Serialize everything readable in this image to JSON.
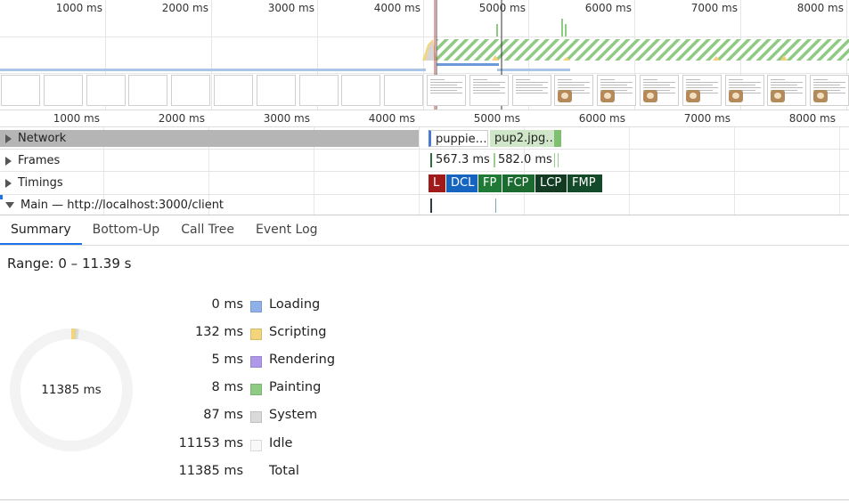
{
  "overview": {
    "ticks": [
      "1000 ms",
      "2000 ms",
      "3000 ms",
      "4000 ms",
      "5000 ms",
      "6000 ms",
      "7000 ms",
      "8000 ms"
    ]
  },
  "ruler": {
    "ticks": [
      "1000 ms",
      "2000 ms",
      "3000 ms",
      "4000 ms",
      "5000 ms",
      "6000 ms",
      "7000 ms",
      "8000 ms"
    ]
  },
  "tracks": {
    "network": {
      "label": "Network",
      "requests": [
        "puppie…",
        "pup2.jpg…"
      ]
    },
    "frames": {
      "label": "Frames",
      "durations": [
        "567.3 ms",
        "582.0 ms"
      ]
    },
    "timings": {
      "label": "Timings",
      "markers": [
        {
          "label": "L",
          "color": "#a11a1a"
        },
        {
          "label": "DCL",
          "color": "#1565c0"
        },
        {
          "label": "FP",
          "color": "#1e7a35"
        },
        {
          "label": "FCP",
          "color": "#1b6a30"
        },
        {
          "label": "LCP",
          "color": "#133b22"
        },
        {
          "label": "FMP",
          "color": "#124a2a"
        }
      ]
    },
    "main": {
      "label": "Main — http://localhost:3000/client"
    }
  },
  "tabs": [
    {
      "label": "Summary",
      "active": true
    },
    {
      "label": "Bottom-Up",
      "active": false
    },
    {
      "label": "Call Tree",
      "active": false
    },
    {
      "label": "Event Log",
      "active": false
    }
  ],
  "summary": {
    "range": "Range: 0 – 11.39 s",
    "total_display": "11385 ms",
    "rows": [
      {
        "value": "0 ms",
        "name": "Loading",
        "color": "#8fb0e8",
        "ms": 0
      },
      {
        "value": "132 ms",
        "name": "Scripting",
        "color": "#f2d47a",
        "ms": 132
      },
      {
        "value": "5 ms",
        "name": "Rendering",
        "color": "#ae98e8",
        "ms": 5
      },
      {
        "value": "8 ms",
        "name": "Painting",
        "color": "#8ecb83",
        "ms": 8
      },
      {
        "value": "87 ms",
        "name": "System",
        "color": "#dadada",
        "ms": 87
      },
      {
        "value": "11153 ms",
        "name": "Idle",
        "color": "#f8f8f8",
        "ms": 11153
      },
      {
        "value": "11385 ms",
        "name": "Total",
        "color": "",
        "ms": 11385
      }
    ]
  }
}
